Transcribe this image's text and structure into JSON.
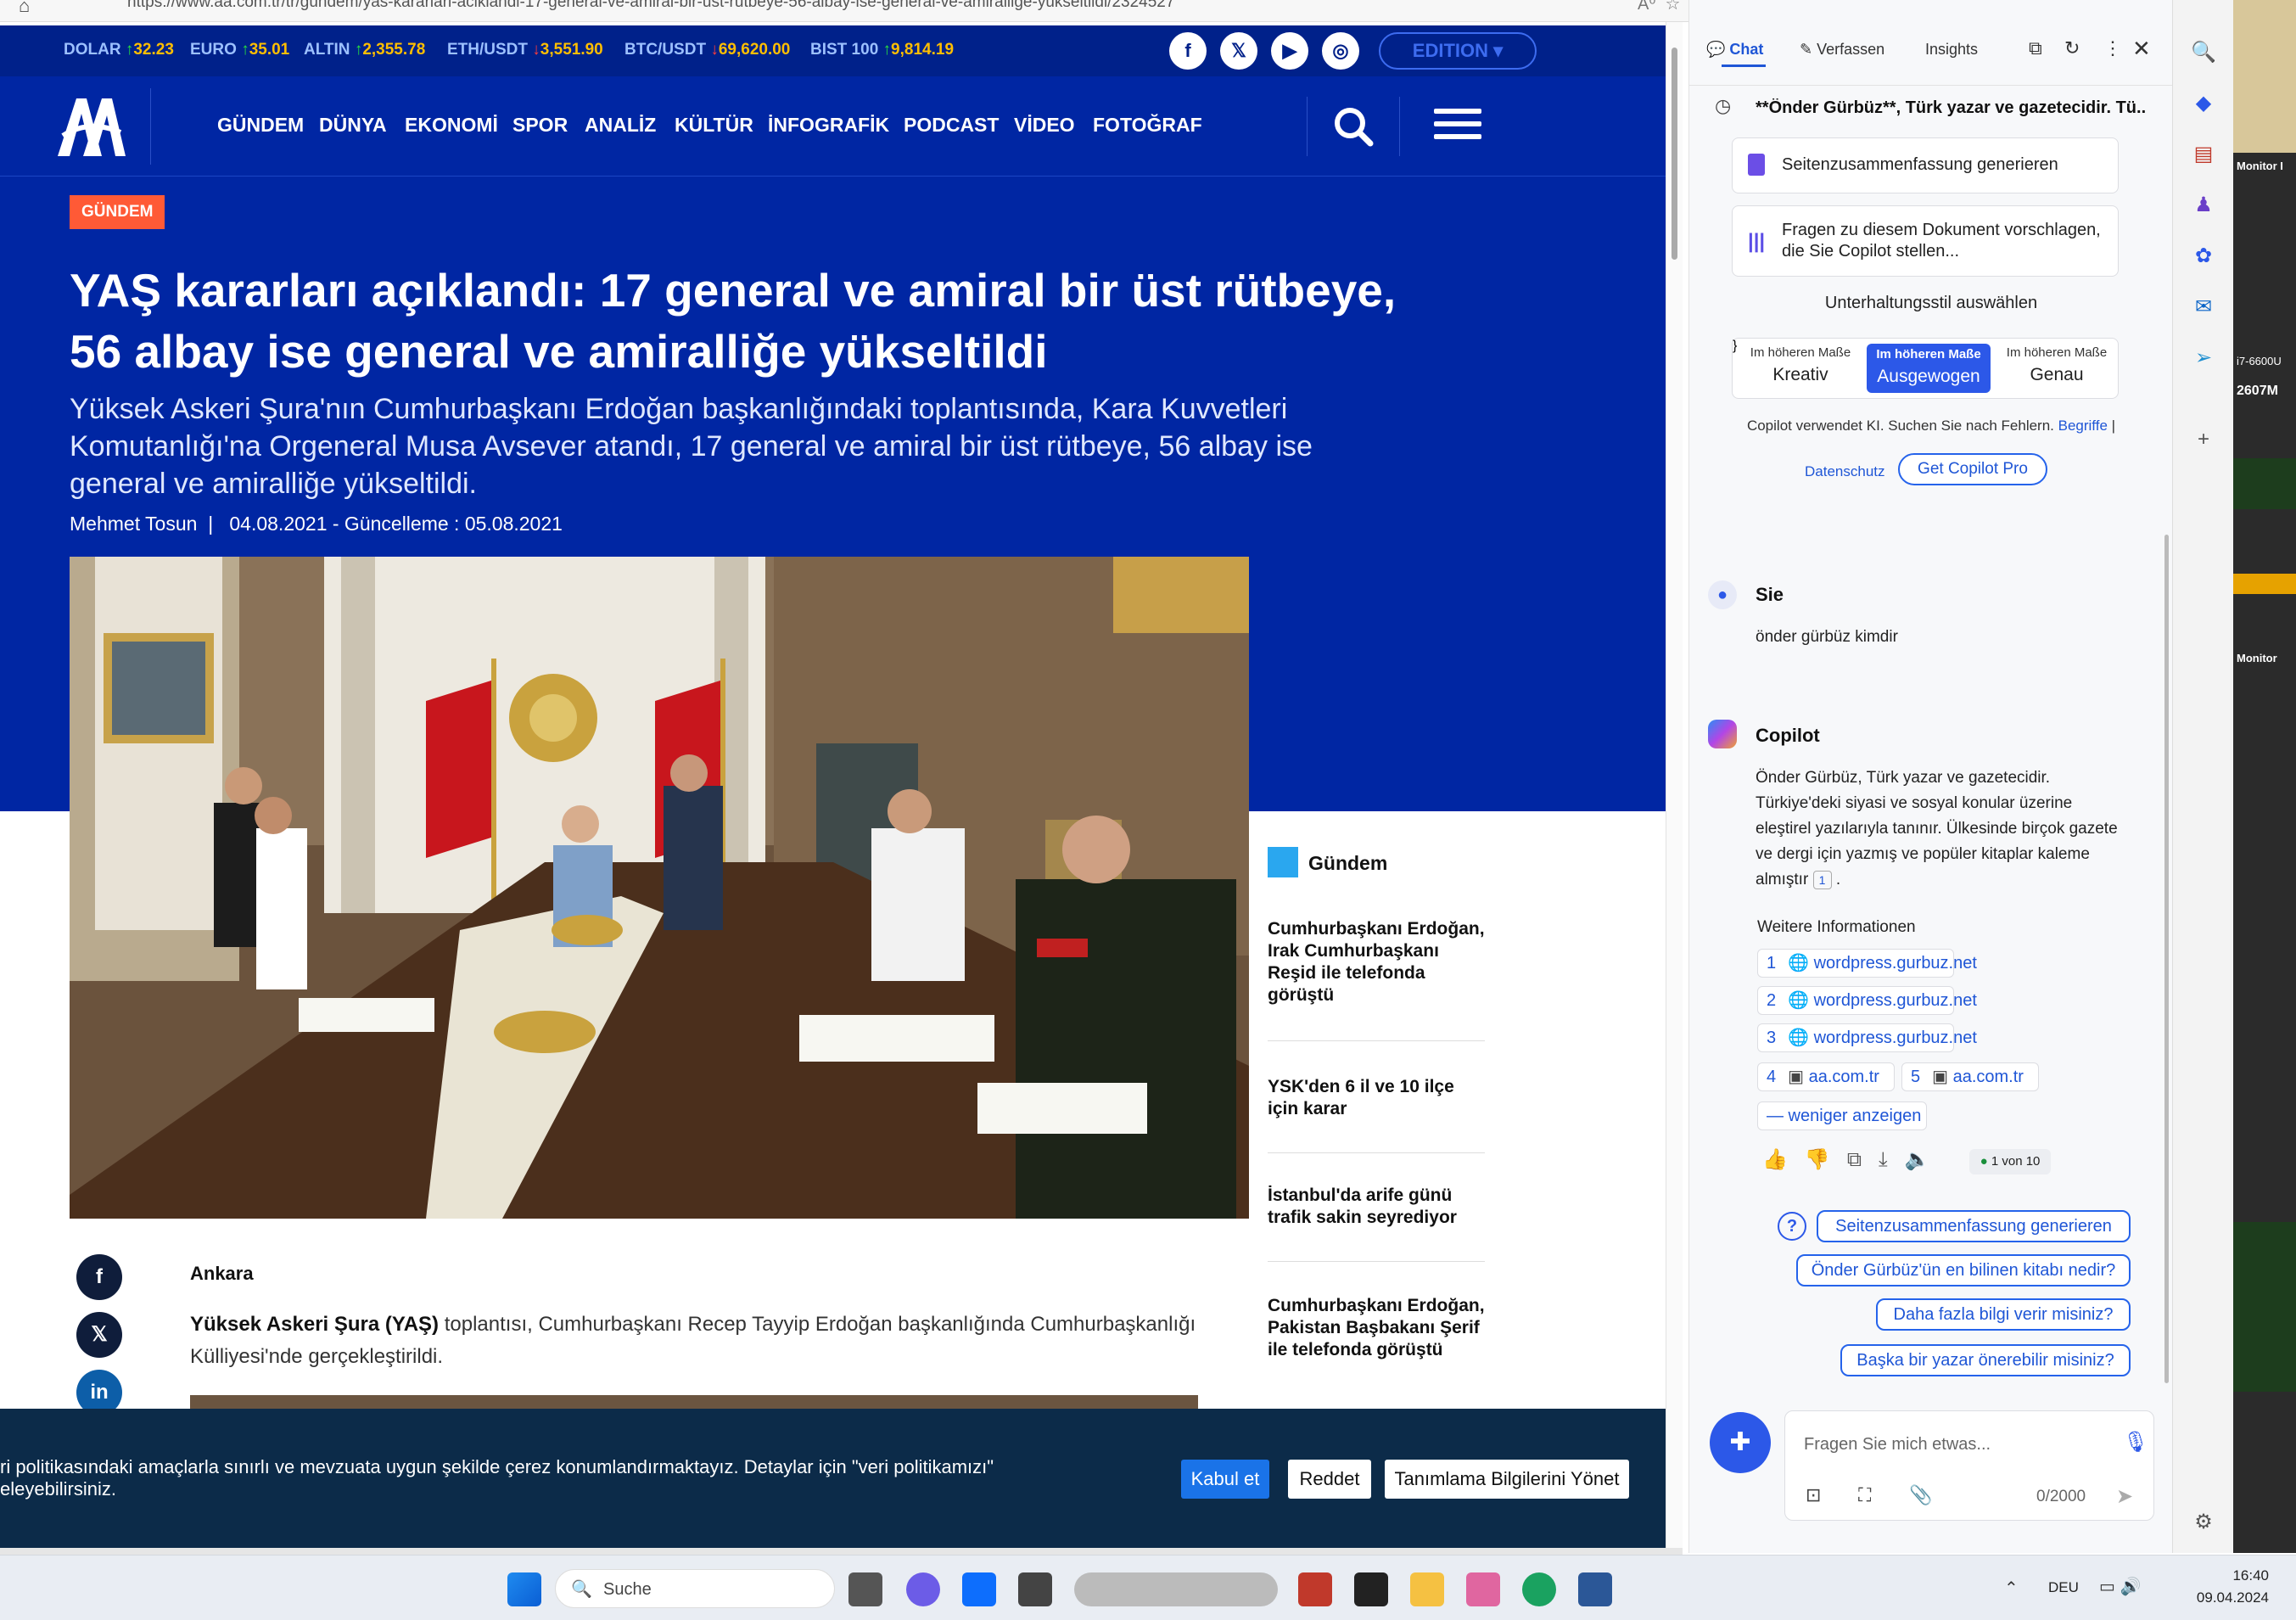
{
  "browser": {
    "url": "https://www.aa.com.tr/tr/gundem/yas-kararlari-aciklandi-17-general-ve-amiral-bir-ust-rutbeye-56-albay-ise-general-ve-amiralligе-yukseltildi/2324527",
    "url_short": "https://www.aa.com.tr/tr/gundem/yas-kararlari-aciklandi-17-general-ve-amiral-bir-ust-rutbeye-56-albay-ise-general-ve-amiralligе-yukseltildi/2324527"
  },
  "ticker": [
    {
      "label": "DOLAR",
      "dir": "up",
      "value": "32.23"
    },
    {
      "label": "EURO",
      "dir": "up",
      "value": "35.01"
    },
    {
      "label": "ALTIN",
      "dir": "up",
      "value": "2,355.78"
    },
    {
      "label": "ETH/USDT",
      "dir": "down",
      "value": "3,551.90"
    },
    {
      "label": "BTC/USDT",
      "dir": "down",
      "value": "69,620.00"
    },
    {
      "label": "BIST 100",
      "dir": "up",
      "value": "9,814.19"
    }
  ],
  "social": [
    "facebook-icon",
    "x-icon",
    "youtube-icon",
    "instagram-icon"
  ],
  "edition_label": "EDITION",
  "nav": [
    "GÜNDEM",
    "DÜNYA",
    "EKONOMİ",
    "SPOR",
    "ANALİZ",
    "KÜLTÜR",
    "İNFOGRAFİK",
    "PODCAST",
    "VİDEO",
    "FOTOĞRAF"
  ],
  "article": {
    "category": "GÜNDEM",
    "headline": "YAŞ kararları açıklandı: 17 general ve amiral bir üst rütbeye, 56 albay ise general ve amiralliğe yükseltildi",
    "lead": "Yüksek Askeri Şura'nın Cumhurbaşkanı Erdoğan başkanlığındaki toplantısında, Kara Kuvvetleri Komutanlığı'na Orgeneral Musa Avsever atandı, 17 general ve amiral bir üst rütbeye, 56 albay ise general ve amiralliğe yükseltildi.",
    "author": "Mehmet Tosun",
    "dates": "04.08.2021 - Güncelleme : 05.08.2021",
    "dateline": "Ankara",
    "body_bold": "Yüksek Askeri Şura (YAŞ)",
    "body_rest": " toplantısı, Cumhurbaşkanı Recep Tayyip Erdoğan başkanlığında Cumhurbaşkanlığı Külliyesi'nde gerçekleştirildi."
  },
  "sidebar": {
    "heading": "Gündem",
    "items": [
      "Cumhurbaşkanı Erdoğan, Irak Cumhurbaşkanı Reşid ile telefonda görüştü",
      "YSK'den 6 il ve 10 ilçe için karar",
      "İstanbul'da arife günü trafik sakin seyrediyor",
      "Cumhurbaşkanı Erdoğan, Pakistan Başbakanı Şerif ile telefonda görüştü"
    ]
  },
  "cookie": {
    "text": "ri politikasındaki amaçlarla sınırlı ve mevzuata uygun şekilde çerez konumlandırmaktayız. Detaylar için \"veri politikamızı\" eleyebilirsiniz.",
    "accept": "Kabul et",
    "reject": "Reddet",
    "manage": "Tanımlama Bilgilerini Yönet"
  },
  "copilot": {
    "tabs": [
      "Chat",
      "Verfassen",
      "Insights"
    ],
    "thread_title": "**Önder Gürbüz**, Türk yazar ve gazetecidir. Tü...",
    "card1": "Seitenzusammenfassung generieren",
    "card2": "Fragen zu diesem Dokument vorschlagen, die Sie Copilot stellen...",
    "style_heading": "Unterhaltungsstil auswählen",
    "styles": [
      {
        "top": "Im höheren Maße",
        "main": "Kreativ"
      },
      {
        "top": "Im höheren Maße",
        "main": "Ausgewogen"
      },
      {
        "top": "Im höheren Maße",
        "main": "Genau"
      }
    ],
    "disclaimer": "Copilot verwendet KI. Suchen Sie nach Fehlern.",
    "terms_link": "Begriffe",
    "privacy_link": "Datenschutz",
    "pro_button": "Get Copilot Pro",
    "user_name": "Sie",
    "user_msg": "önder gürbüz kimdir",
    "bot_name": "Copilot",
    "bot_msg": "Önder Gürbüz, Türk yazar ve gazetecidir. Türkiye'deki siyasi ve sosyal konular üzerine eleştirel yazılarıyla tanınır. Ülkesinde birçok gazete ve dergi için yazmış ve popüler kitaplar kaleme almıştır",
    "bot_cite": "1",
    "more_info": "Weitere Informationen",
    "refs": [
      {
        "n": "1",
        "site": "wordpress.gurbuz.net"
      },
      {
        "n": "2",
        "site": "wordpress.gurbuz.net"
      },
      {
        "n": "3",
        "site": "wordpress.gurbuz.net"
      },
      {
        "n": "4",
        "site": "aa.com.tr"
      },
      {
        "n": "5",
        "site": "aa.com.tr"
      }
    ],
    "show_less": "— weniger anzeigen",
    "counter": "1 von 10",
    "suggestions": [
      "Seitenzusammenfassung generieren",
      "Önder Gürbüz'ün en bilinen kitabı nedir?",
      "Daha fazla bilgi verir misiniz?",
      "Başka bir yazar önerebilir misiniz?"
    ],
    "input_placeholder": "Fragen Sie mich etwas...",
    "char_count": "0/2000"
  },
  "taskbar": {
    "search_label": "Suche",
    "lang": "DEU",
    "time": "16:40",
    "date": "09.04.2024"
  },
  "monitor_labels": [
    "Monitor I",
    "i7-6600U",
    "2607M",
    "Monitor"
  ]
}
